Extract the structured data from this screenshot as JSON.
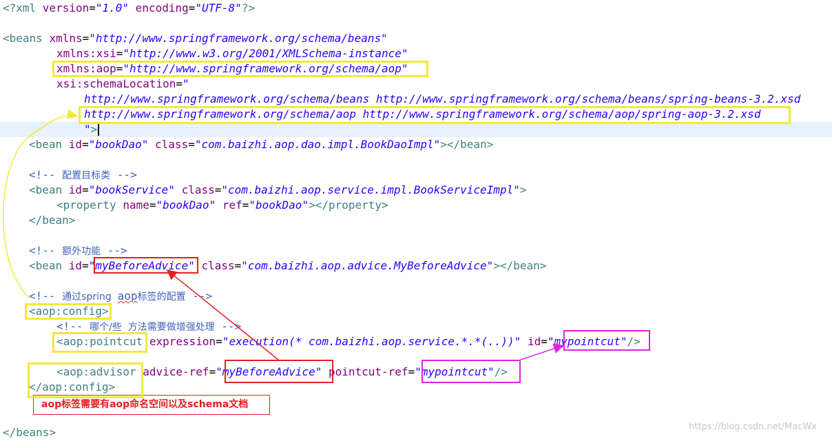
{
  "editor": {
    "lines": [
      {
        "segments": [
          [
            "pi",
            "<?"
          ],
          [
            "tag",
            "xml "
          ],
          [
            "attr",
            "version"
          ],
          [
            "pun",
            "="
          ],
          [
            "val",
            "\"1.0\""
          ],
          [
            "attr",
            " encoding"
          ],
          [
            "pun",
            "="
          ],
          [
            "val",
            "\"UTF-8\""
          ],
          [
            "pi",
            "?>"
          ]
        ]
      },
      {
        "segments": [
          [
            "tag",
            "<beans "
          ],
          [
            "attr",
            "xmlns"
          ],
          [
            "pun",
            "="
          ],
          [
            "val",
            "\"http://www.springframework.org/schema/beans\""
          ]
        ]
      },
      {
        "segments": [
          [
            "attr",
            "xmlns:xsi"
          ],
          [
            "pun",
            "="
          ],
          [
            "val",
            "\"http://www.w3.org/2001/XMLSchema-instance\""
          ]
        ]
      },
      {
        "segments": [
          [
            "attr",
            "xmlns:aop"
          ],
          [
            "pun",
            "="
          ],
          [
            "val",
            "\"http://www.springframework.org/schema/aop\""
          ]
        ]
      },
      {
        "segments": [
          [
            "attr",
            "xsi:schemaLocation"
          ],
          [
            "pun",
            "="
          ],
          [
            "val",
            "\""
          ]
        ]
      },
      {
        "segments": [
          [
            "val",
            "http://www.springframework.org/schema/beans http://www.springframework.org/schema/beans/spring-beans-3.2.xsd"
          ]
        ]
      },
      {
        "segments": [
          [
            "val",
            "http://www.springframework.org/schema/aop http://www.springframework.org/schema/aop/spring-aop-3.2.xsd"
          ]
        ]
      },
      {
        "segments": [
          [
            "val",
            "\""
          ],
          [
            "tag",
            ">"
          ]
        ]
      },
      {
        "segments": [
          [
            "tag",
            "<bean "
          ],
          [
            "attr",
            "id"
          ],
          [
            "pun",
            "="
          ],
          [
            "val",
            "\"bookDao\""
          ],
          [
            "attr",
            " class"
          ],
          [
            "pun",
            "="
          ],
          [
            "val",
            "\"com.baizhi.aop.dao.impl.BookDaoImpl\""
          ],
          [
            "tag",
            "></bean>"
          ]
        ]
      },
      {
        "segments": []
      },
      {
        "segments": [
          [
            "cmt",
            "<!-- "
          ],
          [
            "cmtcn",
            "配置目标类"
          ],
          [
            "cmt",
            " -->"
          ]
        ]
      },
      {
        "segments": [
          [
            "tag",
            "<bean "
          ],
          [
            "attr",
            "id"
          ],
          [
            "pun",
            "="
          ],
          [
            "val",
            "\"bookService\""
          ],
          [
            "attr",
            " class"
          ],
          [
            "pun",
            "="
          ],
          [
            "val",
            "\"com.baizhi.aop.service.impl.BookServiceImpl\""
          ],
          [
            "tag",
            ">"
          ]
        ]
      },
      {
        "segments": [
          [
            "tag",
            "<property "
          ],
          [
            "attr",
            "name"
          ],
          [
            "pun",
            "="
          ],
          [
            "val",
            "\"bookDao\""
          ],
          [
            "attr",
            " ref"
          ],
          [
            "pun",
            "="
          ],
          [
            "val",
            "\"bookDao\""
          ],
          [
            "tag",
            "></property>"
          ]
        ]
      },
      {
        "segments": [
          [
            "tag",
            "</bean>"
          ]
        ]
      },
      {
        "segments": []
      },
      {
        "segments": [
          [
            "cmt",
            "<!-- "
          ],
          [
            "cmtcn",
            "额外功能"
          ],
          [
            "cmt",
            " -->"
          ]
        ]
      },
      {
        "segments": [
          [
            "tag",
            "<bean "
          ],
          [
            "attr",
            "id"
          ],
          [
            "pun",
            "="
          ],
          [
            "val",
            "\"myBeforeAdvice\""
          ],
          [
            "attr",
            " class"
          ],
          [
            "pun",
            "="
          ],
          [
            "val",
            "\"com.baizhi.aop.advice.MyBeforeAdvice\""
          ],
          [
            "tag",
            "></bean>"
          ]
        ]
      },
      {
        "segments": []
      },
      {
        "segments": [
          [
            "cmt",
            "<!-- "
          ],
          [
            "cmtcn",
            "通过spring  "
          ],
          [
            "cmtsq",
            "aop"
          ],
          [
            "cmtcn",
            "标签的配置"
          ],
          [
            "cmt",
            " -->"
          ]
        ]
      },
      {
        "segments": [
          [
            "tag",
            "<aop:config>"
          ]
        ]
      },
      {
        "segments": [
          [
            "cmt",
            "<!-- "
          ],
          [
            "cmtcn",
            "哪个/些  方法需要做增强处理"
          ],
          [
            "cmt",
            " -->"
          ]
        ]
      },
      {
        "segments": [
          [
            "tag",
            "<aop:pointcut "
          ],
          [
            "attr",
            "expression"
          ],
          [
            "pun",
            "="
          ],
          [
            "val",
            "\"execution(* com.baizhi.aop.service.*.*(..))\""
          ],
          [
            "attr",
            " id"
          ],
          [
            "pun",
            "="
          ],
          [
            "val",
            "\"mypointcut\""
          ],
          [
            "tag",
            "/>"
          ]
        ]
      },
      {
        "segments": []
      },
      {
        "segments": [
          [
            "tag",
            "<aop:advisor "
          ],
          [
            "attr",
            "advice-ref"
          ],
          [
            "pun",
            "="
          ],
          [
            "val",
            "\"myBeforeAdvice\""
          ],
          [
            "attr",
            " pointcut-ref"
          ],
          [
            "pun",
            "="
          ],
          [
            "val",
            "\"mypointcut\""
          ],
          [
            "tag",
            "/>"
          ]
        ]
      },
      {
        "segments": [
          [
            "tag",
            "</aop:config>"
          ]
        ]
      },
      {
        "segments": []
      },
      {
        "segments": []
      },
      {
        "segments": [
          [
            "tag",
            "</beans>"
          ]
        ]
      }
    ]
  },
  "annotation": {
    "note": "aop标签需要有aop命名空间以及schema文档"
  },
  "watermark": "https://blog.csdn.net/MacWx",
  "colors": {
    "tag": "#3f7f7f",
    "attribute": "#7f007f",
    "value": "#2a00ff",
    "comment": "#3f5fbf",
    "highlight_yellow": "#f5e73a",
    "highlight_red": "#e02020",
    "highlight_magenta": "#e020e0",
    "current_line": "#e8f2fe"
  }
}
